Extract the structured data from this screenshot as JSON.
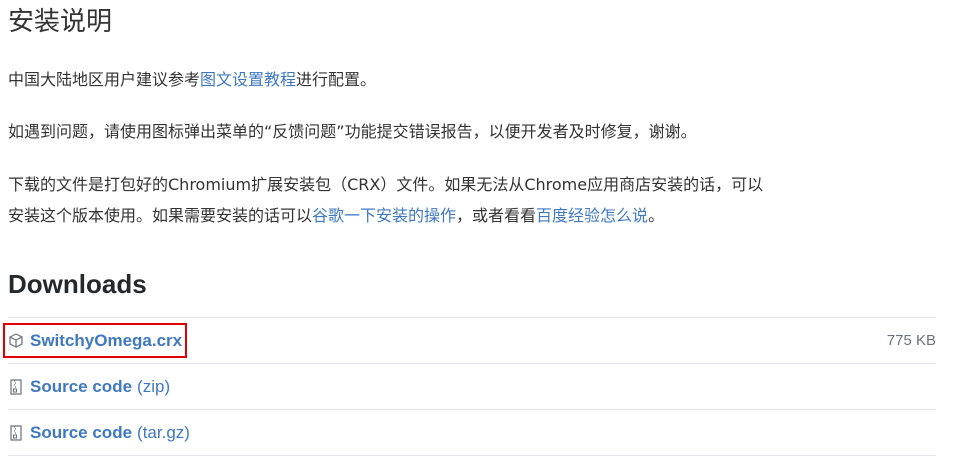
{
  "heading": "安装说明",
  "para1": {
    "before": "中国大陆地区用户建议参考",
    "link": "图文设置教程",
    "after": "进行配置。"
  },
  "para2": "如遇到问题，请使用图标弹出菜单的“反馈问题”功能提交错误报告，以便开发者及时修复，谢谢。",
  "para3": {
    "line1": "下载的文件是打包好的Chromium扩展安装包（CRX）文件。如果无法从Chrome应用商店安装的话，可以",
    "line2_before": "安装这个版本使用。如果需要安装的话可以",
    "link1": "谷歌一下安装的操作",
    "middle": "，或者看看",
    "link2": "百度经验怎么说",
    "end": "。"
  },
  "downloads": {
    "title": "Downloads",
    "items": [
      {
        "name": "SwitchyOmega.crx",
        "suffix": "",
        "size": "775 KB",
        "icon": "package-icon"
      },
      {
        "name": "Source code",
        "suffix": "(zip)",
        "size": "",
        "icon": "file-zip-icon"
      },
      {
        "name": "Source code",
        "suffix": "(tar.gz)",
        "size": "",
        "icon": "file-zip-icon"
      }
    ]
  },
  "colors": {
    "link": "#4078c0",
    "highlight": "#e00000",
    "divider": "#e1e4e8"
  }
}
